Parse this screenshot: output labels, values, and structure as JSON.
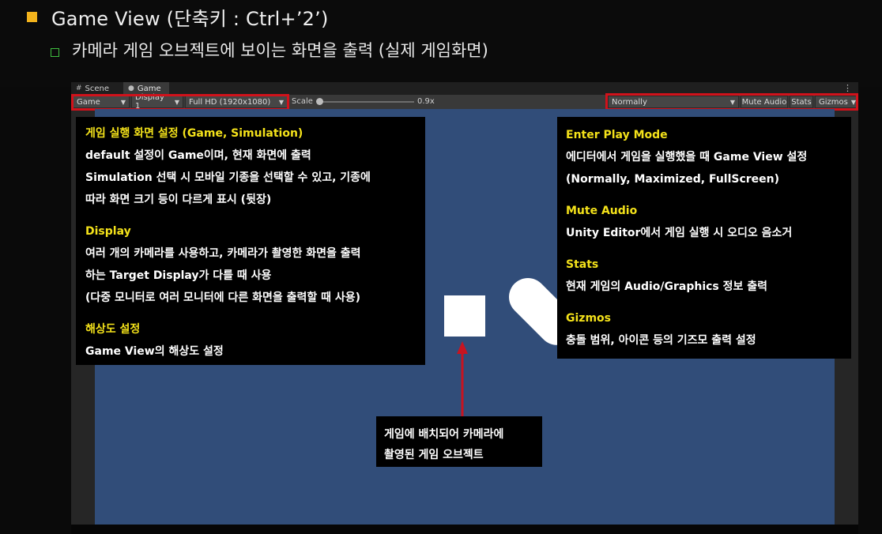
{
  "slide": {
    "title": "Game View (단축키 : Ctrl+’2’)",
    "subtitle": "카메라 게임 오브젝트에 보이는 화면을 출력 (실제 게임화면)"
  },
  "tabs": {
    "scene": "Scene",
    "game": "Game"
  },
  "toolbar": {
    "mode": "Game",
    "display": "Display 1",
    "resolution": "Full HD (1920x1080)",
    "scale_label": "Scale",
    "scale_value": "0.9x",
    "play_mode": "Normally",
    "mute": "Mute Audio",
    "stats": "Stats",
    "gizmos": "Gizmos"
  },
  "notes_left": {
    "h1": "게임 실행 화면 설정 (Game, Simulation)",
    "l1": "default 설정이 Game이며, 현재 화면에 출력",
    "l2": "Simulation 선택 시 모바일 기종을 선택할 수 있고, 기종에",
    "l3": "따라 화면 크기 등이 다르게 표시 (뒷장)",
    "h2": "Display",
    "l4": "여러 개의 카메라를 사용하고, 카메라가 촬영한 화면을 출력",
    "l5": "하는 Target Display가 다를 때 사용",
    "l6": "(다중 모니터로 여러 모니터에 다른 화면을 출력할 때 사용)",
    "h3": "해상도 설정",
    "l7": "Game View의 해상도 설정"
  },
  "notes_right": {
    "h1": "Enter Play Mode",
    "l1": "에디터에서 게임을 실행했을 때 Game View 설정",
    "l2": "(Normally, Maximized, FullScreen)",
    "h2": "Mute Audio",
    "l3": "Unity Editor에서 게임 실행 시 오디오 음소거",
    "h3": "Stats",
    "l4": "현재 게임의 Audio/Graphics 정보 출력",
    "h4": "Gizmos",
    "l5": "충돌 범위, 아이콘 등의 기즈모 출력 설정"
  },
  "notes_bottom": {
    "l1": "게임에 배치되어 카메라에",
    "l2": "촬영된 게임 오브젝트"
  },
  "colors": {
    "accent_yellow": "#f4e21a",
    "highlight_red": "#d1121b",
    "viewport_blue": "#314d79",
    "bullet_orange": "#f3b31c"
  }
}
